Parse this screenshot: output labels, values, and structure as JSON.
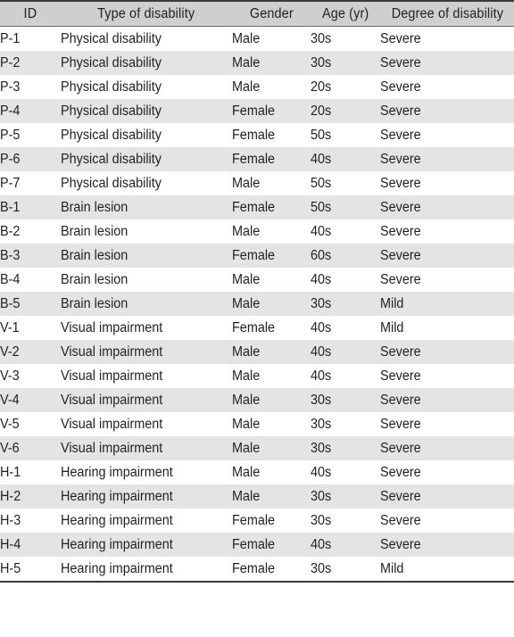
{
  "table": {
    "columns": [
      {
        "key": "id",
        "label": "ID"
      },
      {
        "key": "type",
        "label": "Type of disability"
      },
      {
        "key": "gender",
        "label": "Gender"
      },
      {
        "key": "age",
        "label": "Age (yr)"
      },
      {
        "key": "degree",
        "label": "Degree of disability"
      }
    ],
    "rows": [
      {
        "id": "P-1",
        "type": "Physical disability",
        "gender": "Male",
        "age": "30s",
        "degree": "Severe"
      },
      {
        "id": "P-2",
        "type": "Physical disability",
        "gender": "Male",
        "age": "30s",
        "degree": "Severe"
      },
      {
        "id": "P-3",
        "type": "Physical disability",
        "gender": "Male",
        "age": "20s",
        "degree": "Severe"
      },
      {
        "id": "P-4",
        "type": "Physical disability",
        "gender": "Female",
        "age": "20s",
        "degree": "Severe"
      },
      {
        "id": "P-5",
        "type": "Physical disability",
        "gender": "Female",
        "age": "50s",
        "degree": "Severe"
      },
      {
        "id": "P-6",
        "type": "Physical disability",
        "gender": "Female",
        "age": "40s",
        "degree": "Severe"
      },
      {
        "id": "P-7",
        "type": "Physical disability",
        "gender": "Male",
        "age": "50s",
        "degree": "Severe"
      },
      {
        "id": "B-1",
        "type": "Brain lesion",
        "gender": "Female",
        "age": "50s",
        "degree": "Severe"
      },
      {
        "id": "B-2",
        "type": "Brain lesion",
        "gender": "Male",
        "age": "40s",
        "degree": "Severe"
      },
      {
        "id": "B-3",
        "type": "Brain lesion",
        "gender": "Female",
        "age": "60s",
        "degree": "Severe"
      },
      {
        "id": "B-4",
        "type": "Brain lesion",
        "gender": "Male",
        "age": "40s",
        "degree": "Severe"
      },
      {
        "id": "B-5",
        "type": "Brain lesion",
        "gender": "Male",
        "age": "30s",
        "degree": "Mild"
      },
      {
        "id": "V-1",
        "type": "Visual impairment",
        "gender": "Female",
        "age": "40s",
        "degree": "Mild"
      },
      {
        "id": "V-2",
        "type": "Visual impairment",
        "gender": "Male",
        "age": "40s",
        "degree": "Severe"
      },
      {
        "id": "V-3",
        "type": "Visual impairment",
        "gender": "Male",
        "age": "40s",
        "degree": "Severe"
      },
      {
        "id": "V-4",
        "type": "Visual impairment",
        "gender": "Male",
        "age": "30s",
        "degree": "Severe"
      },
      {
        "id": "V-5",
        "type": "Visual impairment",
        "gender": "Male",
        "age": "30s",
        "degree": "Severe"
      },
      {
        "id": "V-6",
        "type": "Visual impairment",
        "gender": "Male",
        "age": "30s",
        "degree": "Severe"
      },
      {
        "id": "H-1",
        "type": "Hearing impairment",
        "gender": "Male",
        "age": "40s",
        "degree": "Severe"
      },
      {
        "id": "H-2",
        "type": "Hearing impairment",
        "gender": "Male",
        "age": "30s",
        "degree": "Severe"
      },
      {
        "id": "H-3",
        "type": "Hearing impairment",
        "gender": "Female",
        "age": "30s",
        "degree": "Severe"
      },
      {
        "id": "H-4",
        "type": "Hearing impairment",
        "gender": "Female",
        "age": "40s",
        "degree": "Severe"
      },
      {
        "id": "H-5",
        "type": "Hearing impairment",
        "gender": "Female",
        "age": "30s",
        "degree": "Mild"
      }
    ]
  },
  "style": {
    "header_bg": "#cfcfcf",
    "row_shade_bg": "#e4e4e4",
    "row_plain_bg": "#ffffff",
    "rule_color": "#3a3a3a",
    "text_color": "#231f20"
  }
}
